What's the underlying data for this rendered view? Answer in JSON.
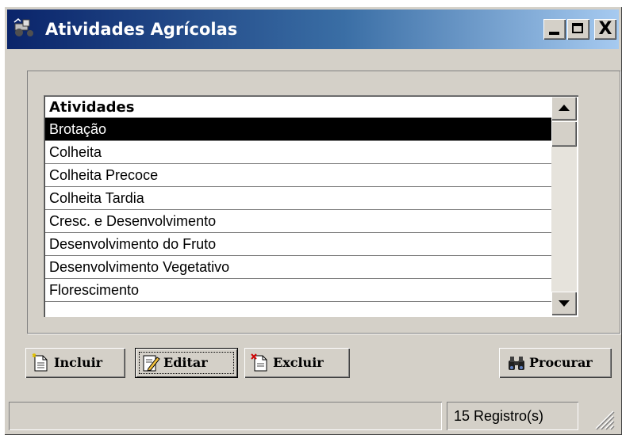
{
  "window": {
    "title": "Atividades Agrícolas",
    "controls": {
      "minimize": "_",
      "maximize": "□",
      "close": "X"
    }
  },
  "grid": {
    "header": "Atividades",
    "selected_index": 0,
    "rows": [
      "Brotação",
      "Colheita",
      "Colheita Precoce",
      "Colheita Tardia",
      "Cresc. e Desenvolvimento",
      "Desenvolvimento do Fruto",
      "Desenvolvimento Vegetativo",
      "Florescimento"
    ]
  },
  "toolbar": {
    "incluir": "Incluir",
    "editar": "Editar",
    "excluir": "Excluir",
    "procurar": "Procurar"
  },
  "status": {
    "count": "15 Registro(s)"
  },
  "colors": {
    "title_start": "#0a246a",
    "title_end": "#a6caf0",
    "face": "#d4d0c8",
    "selection": "#000000"
  },
  "icons": [
    "app-tractor-icon",
    "new-document-icon",
    "edit-pencil-icon",
    "delete-document-icon",
    "binoculars-icon",
    "size-grip-icon"
  ]
}
